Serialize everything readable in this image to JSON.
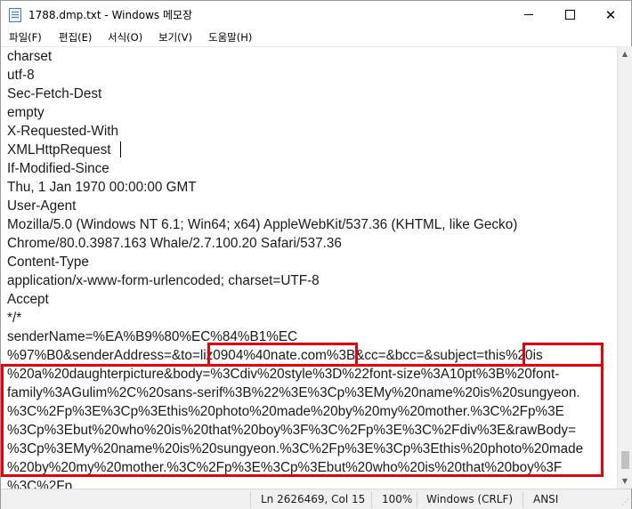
{
  "window": {
    "title": "1788.dmp.txt - Windows 메모장",
    "minimize_glyph": "",
    "maximize_glyph": "",
    "close_glyph": "✕",
    "icon": "notepad-icon"
  },
  "menu": [
    {
      "label": "파일(F)"
    },
    {
      "label": "편집(E)"
    },
    {
      "label": "서식(O)"
    },
    {
      "label": "보기(V)"
    },
    {
      "label": "도움말(H)"
    }
  ],
  "editor": {
    "lines": [
      "charset",
      "utf-8",
      "Sec-Fetch-Dest",
      "empty",
      "X-Requested-With",
      "XMLHttpRequest",
      "If-Modified-Since",
      "Thu, 1 Jan 1970 00:00:00 GMT",
      "User-Agent",
      "Mozilla/5.0 (Windows NT 6.1; Win64; x64) AppleWebKit/537.36 (KHTML, like Gecko)",
      "Chrome/80.0.3987.163 Whale/2.7.100.20 Safari/537.36",
      "Content-Type",
      "application/x-www-form-urlencoded; charset=UTF-8",
      "Accept",
      "*/*",
      "senderName=%EA%B9%80%EC%84%B1%EC",
      "%97%B0&senderAddress=&to=liz0904%40nate.com%3B&cc=&bcc=&subject=this%20is",
      "%20a%20daughterpicture&body=%3Cdiv%20style%3D%22font-size%3A10pt%3B%20font-",
      "family%3AGulim%2C%20sans-serif%3B%22%3E%3Cp%3EMy%20name%20is%20sungyeon.",
      "%3C%2Fp%3E%3Cp%3Ethis%20photo%20made%20by%20my%20mother.%3C%2Fp%3E",
      "%3Cp%3Ebut%20who%20is%20that%20boy%3F%3C%2Fp%3E%3C%2Fdiv%3E&rawBody=",
      "%3Cp%3EMy%20name%20is%20sungyeon.%3C%2Fp%3E%3Cp%3Ethis%20photo%20made",
      "%20by%20my%20mother.%3C%2Fp%3E%3Cp%3Ebut%20who%20is%20that%20boy%3F",
      "%3C%2Fp"
    ],
    "annotation_color": "#e8000d"
  },
  "scrollbar": {
    "up_glyph": "▲",
    "down_glyph": "▼"
  },
  "status": {
    "position": "Ln 2626469, Col 15",
    "zoom": "100%",
    "line_ending": "Windows (CRLF)",
    "encoding": "ANSI",
    "grip_glyph": "⋰"
  }
}
